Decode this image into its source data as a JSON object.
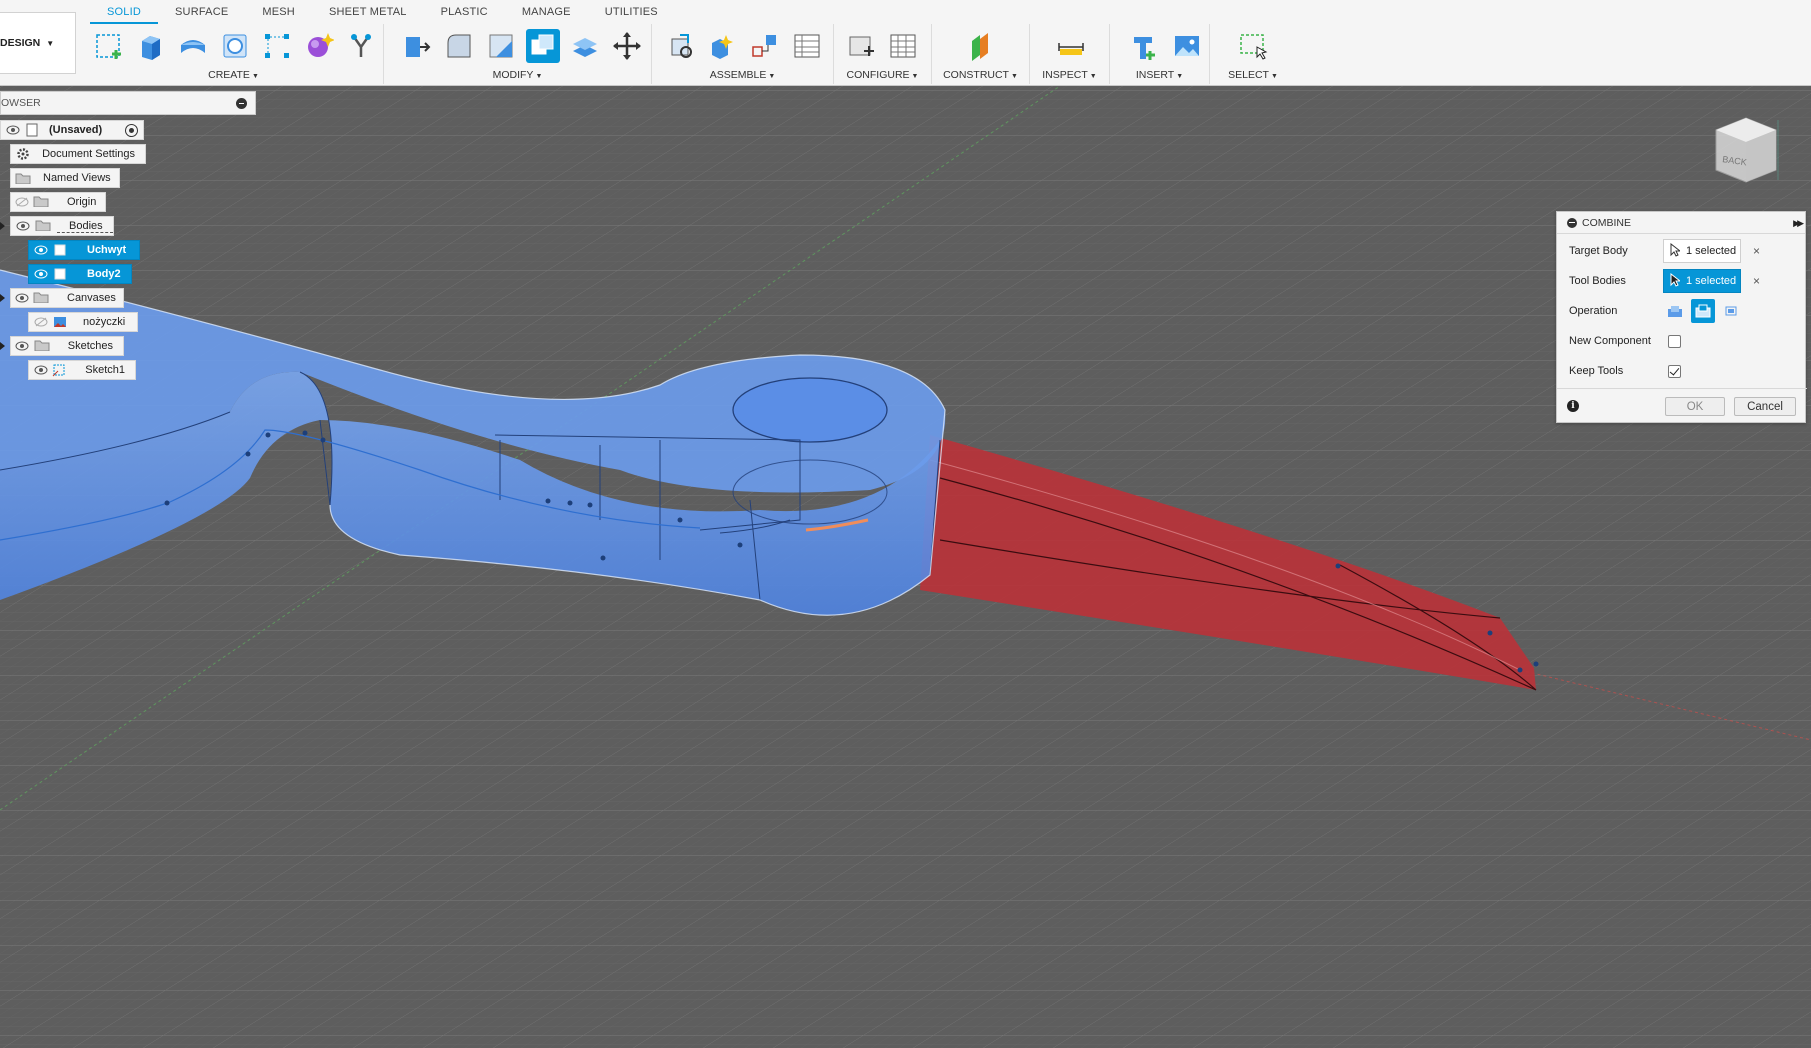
{
  "toolbar": {
    "workspace": "DESIGN",
    "tabs": [
      "SOLID",
      "SURFACE",
      "MESH",
      "SHEET METAL",
      "PLASTIC",
      "MANAGE",
      "UTILITIES"
    ],
    "groups": {
      "create": "CREATE",
      "modify": "MODIFY",
      "assemble": "ASSEMBLE",
      "configure": "CONFIGURE",
      "construct": "CONSTRUCT",
      "inspect": "INSPECT",
      "insert": "INSERT",
      "select": "SELECT"
    }
  },
  "browser": {
    "title": "OWSER",
    "root": "(Unsaved)",
    "items": {
      "document_settings": "Document Settings",
      "named_views": "Named Views",
      "origin": "Origin",
      "bodies": "Bodies",
      "body_uchwyt": "Uchwyt",
      "body_body2": "Body2",
      "canvases": "Canvases",
      "canvas_nozyczki": "nożyczki",
      "sketches": "Sketches",
      "sketch1": "Sketch1"
    }
  },
  "combine": {
    "title": "COMBINE",
    "target_body_label": "Target Body",
    "target_body_value": "1 selected",
    "tool_bodies_label": "Tool Bodies",
    "tool_bodies_value": "1 selected",
    "operation_label": "Operation",
    "new_component_label": "New Component",
    "new_component_checked": false,
    "keep_tools_label": "Keep Tools",
    "keep_tools_checked": true,
    "ok_label": "OK",
    "cancel_label": "Cancel"
  },
  "viewcube": {
    "face_label": "BACK"
  },
  "colors": {
    "accent": "#0696d7",
    "body_blue": "#5b8ee6",
    "body_red": "#b8333a",
    "grid_bg": "#5e5e5e"
  }
}
